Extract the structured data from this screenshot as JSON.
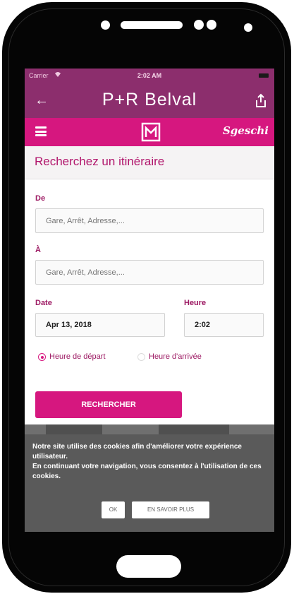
{
  "status_bar": {
    "carrier": "Carrier",
    "time": "2:02 AM"
  },
  "title_bar": {
    "back": "←",
    "title": "P+R Belval"
  },
  "nav_bar": {
    "brand": "Sgeschi"
  },
  "form": {
    "heading": "Recherchez un itinéraire",
    "from_label": "De",
    "from_placeholder": "Gare, Arrêt, Adresse,...",
    "to_label": "À",
    "to_placeholder": "Gare, Arrêt, Adresse,...",
    "date_label": "Date",
    "date_value": "Apr 13, 2018",
    "time_label": "Heure",
    "time_value": "2:02",
    "radio_departure": "Heure de départ",
    "radio_arrival": "Heure d'arrivée",
    "selected_radio": "departure",
    "search_button": "RECHERCHER"
  },
  "cookie_banner": {
    "message_line1": "Notre site utilise des cookies afin d'améliorer votre expérience utilisateur.",
    "message_line2": "En continuant votre navigation, vous consentez à l'utilisation de ces cookies.",
    "ok_button": "OK",
    "more_button": "EN SAVOIR PLUS"
  },
  "colors": {
    "title_bar": "#8c2e6d",
    "nav_bar": "#d6177f",
    "accent_text": "#b1166c",
    "cookie_bg": "#5a5a5a"
  }
}
